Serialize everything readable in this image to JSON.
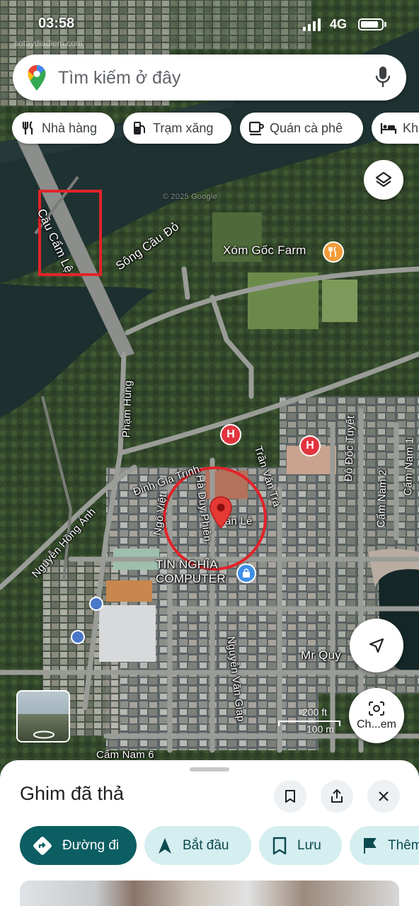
{
  "status": {
    "time": "03:58",
    "network": "4G"
  },
  "watermark": "sotaydiadiem.com",
  "search": {
    "placeholder": "Tìm kiếm ở đây"
  },
  "chips": [
    {
      "label": "Nhà hàng",
      "icon": "fork-knife-icon"
    },
    {
      "label": "Trạm xăng",
      "icon": "gas-pump-icon"
    },
    {
      "label": "Quán cà phê",
      "icon": "coffee-cup-icon"
    },
    {
      "label": "Kh",
      "icon": "bed-icon"
    }
  ],
  "map_labels": {
    "bridge": "Cầu Cẩm Lệ",
    "river": "Sông Cầu Đỏ",
    "farm": "Xóm Gốc Farm",
    "pham_hung": "Phạm Hùng",
    "dinh_gia_trinh": "Đinh Gia Trinh",
    "tran_van_tra": "Trần Văn Trà",
    "do_doc_tuyet": "Đô Đốc Tuyết",
    "cam_nam_1": "Cẩm Nam 1",
    "cam_nam_2": "Cẩm Nam 2",
    "nguyen_hong_anh": "Nguyễn Hồng Ánh",
    "ngo_viet": "Ngô Việt",
    "ha_duy_phien": "Hà Duy Phiên",
    "place_partial": "ẩn Lê",
    "shop": "TÍN NGHĨA COMPUTER",
    "nguyen_van_giap": "Nguyễn Văn Giáp",
    "mr_quy": "Mr Quý",
    "cam_nam_6": "Cẩm Nam 6",
    "copyright": "© 2025 Google"
  },
  "scale": {
    "feet": "200 ft",
    "meters": "100 m"
  },
  "camera_button": {
    "label": "Ch...em"
  },
  "sheet": {
    "title": "Ghim đã thả",
    "actions": [
      {
        "label": "Đường đi",
        "icon": "directions-icon"
      },
      {
        "label": "Bắt đầu",
        "icon": "navigation-arrow-icon"
      },
      {
        "label": "Lưu",
        "icon": "bookmark-icon"
      },
      {
        "label": "Thêm",
        "icon": "flag-icon"
      }
    ]
  },
  "colors": {
    "river": "#1c2e2f",
    "accent_teal": "#0b5e62",
    "chip_bg": "#d5eef0",
    "pin_red": "#e53935",
    "highlight_red": "#e2232a"
  }
}
